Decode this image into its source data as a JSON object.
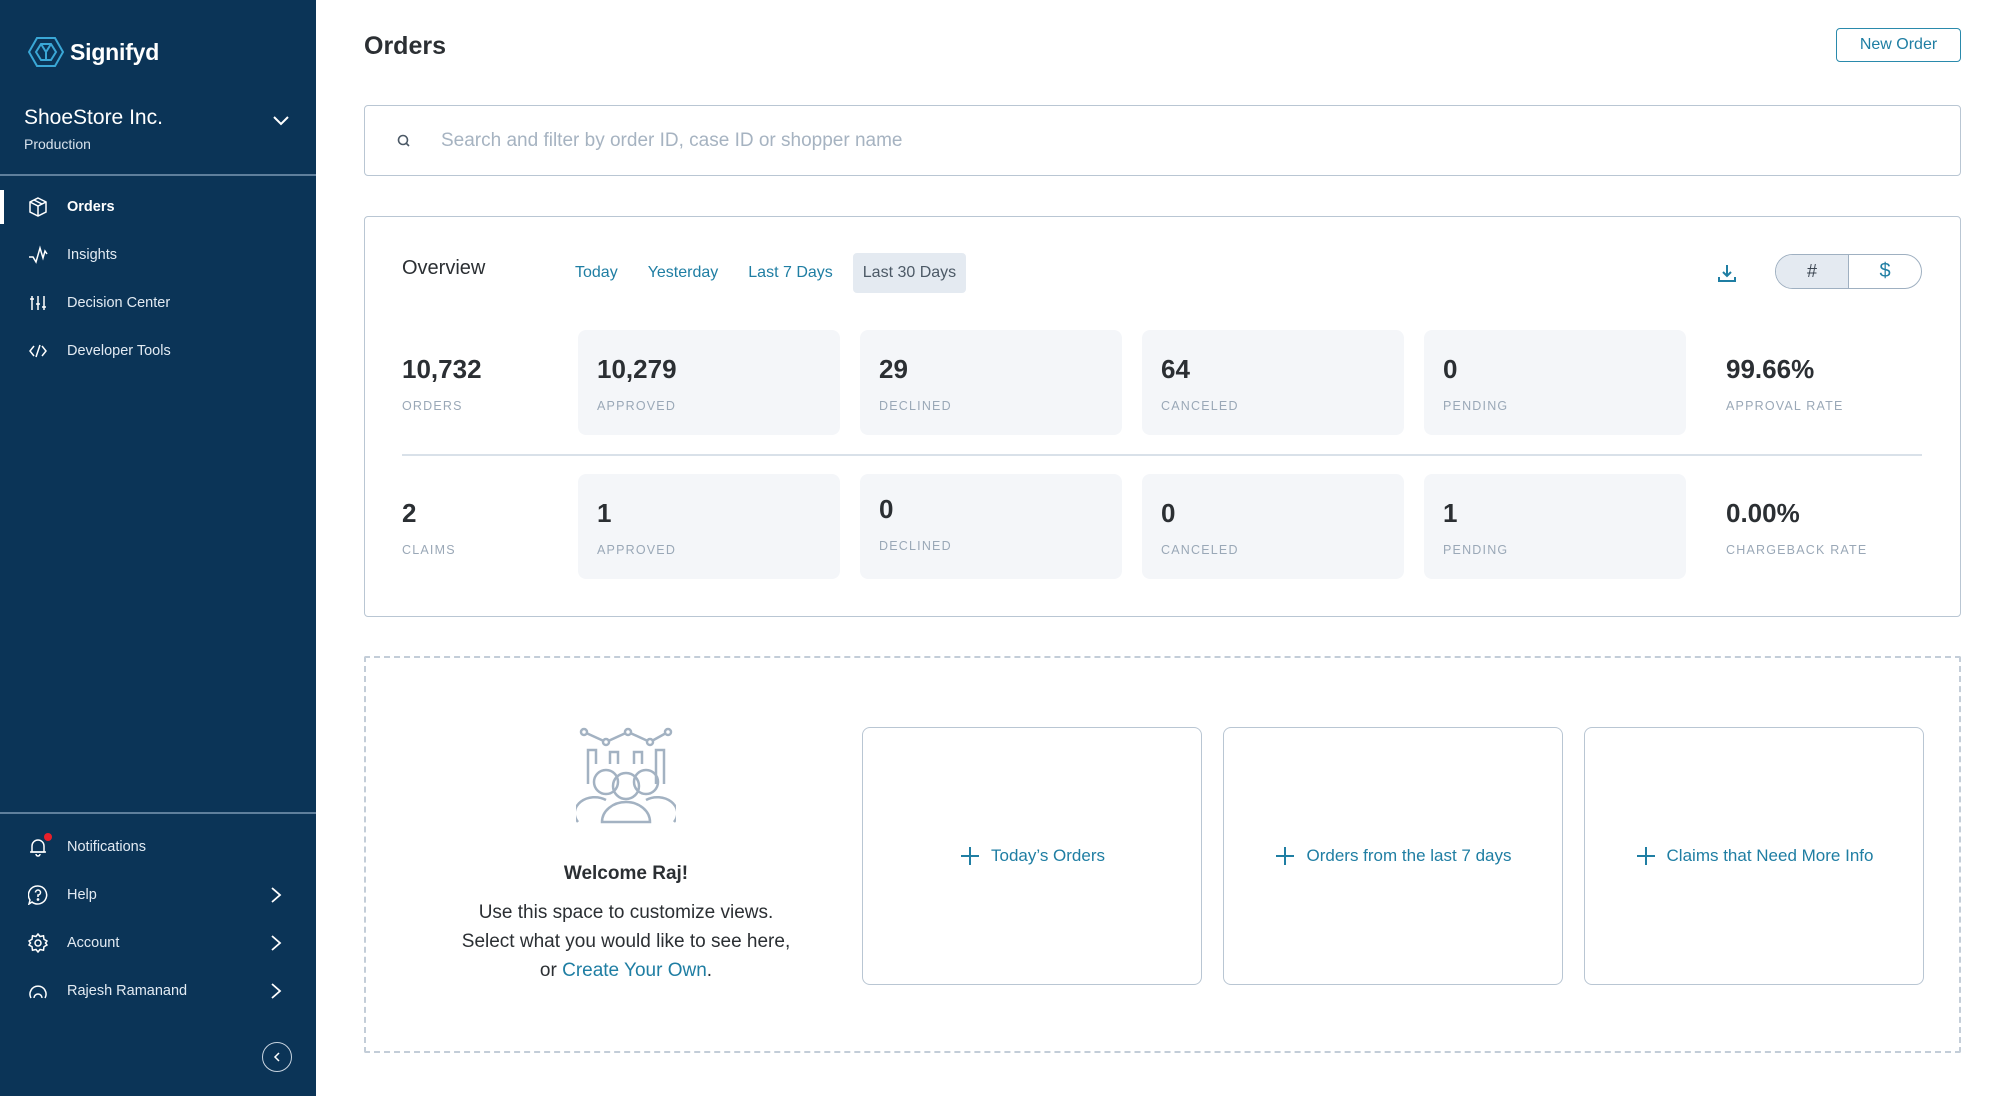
{
  "brand": {
    "name": "Signifyd",
    "accent": "#1f7ea3",
    "sidebar_bg": "#0b3457"
  },
  "account": {
    "store_name": "ShoeStore Inc.",
    "environment": "Production"
  },
  "nav": {
    "primary": [
      {
        "label": "Orders",
        "icon": "box-icon",
        "active": true
      },
      {
        "label": "Insights",
        "icon": "pulse-icon",
        "active": false
      },
      {
        "label": "Decision Center",
        "icon": "sliders-icon",
        "active": false
      },
      {
        "label": "Developer Tools",
        "icon": "code-icon",
        "active": false
      }
    ],
    "secondary": [
      {
        "label": "Notifications",
        "icon": "bell-icon",
        "has_badge": true
      },
      {
        "label": "Help",
        "icon": "help-icon",
        "has_chevron": true
      },
      {
        "label": "Account",
        "icon": "gear-icon",
        "has_chevron": true
      },
      {
        "label": "Rajesh Ramanand",
        "icon": "user-icon",
        "has_chevron": true
      }
    ]
  },
  "header": {
    "title": "Orders",
    "new_order_label": "New Order"
  },
  "search": {
    "placeholder": "Search and filter by order ID, case ID or shopper name",
    "value": ""
  },
  "overview": {
    "title": "Overview",
    "tabs": [
      {
        "label": "Today",
        "selected": false
      },
      {
        "label": "Yesterday",
        "selected": false
      },
      {
        "label": "Last 7 Days",
        "selected": false
      },
      {
        "label": "Last 30 Days",
        "selected": true
      }
    ],
    "unit_toggle": {
      "options": [
        "#",
        "$"
      ],
      "selected": "#"
    },
    "orders_row": [
      {
        "value": "10,732",
        "caption": "ORDERS"
      },
      {
        "value": "10,279",
        "caption": "APPROVED"
      },
      {
        "value": "29",
        "caption": "DECLINED"
      },
      {
        "value": "64",
        "caption": "CANCELED"
      },
      {
        "value": "0",
        "caption": "PENDING"
      },
      {
        "value": "99.66%",
        "caption": "APPROVAL RATE"
      }
    ],
    "claims_row": [
      {
        "value": "2",
        "caption": "CLAIMS"
      },
      {
        "value": "1",
        "caption": "APPROVED"
      },
      {
        "value": "0",
        "caption": "DECLINED"
      },
      {
        "value": "0",
        "caption": "CANCELED"
      },
      {
        "value": "1",
        "caption": "PENDING"
      },
      {
        "value": "0.00%",
        "caption": "CHARGEBACK RATE"
      }
    ]
  },
  "custom_views": {
    "welcome_title": "Welcome Raj!",
    "line1": "Use this space to customize views.",
    "line2": "Select what you would like to see here,",
    "line3_prefix": "or ",
    "link": "Create Your Own",
    "line3_suffix": ".",
    "widgets": [
      {
        "label": "Today’s Orders"
      },
      {
        "label": "Orders from the last 7 days"
      },
      {
        "label": "Claims that Need More Info"
      }
    ]
  }
}
